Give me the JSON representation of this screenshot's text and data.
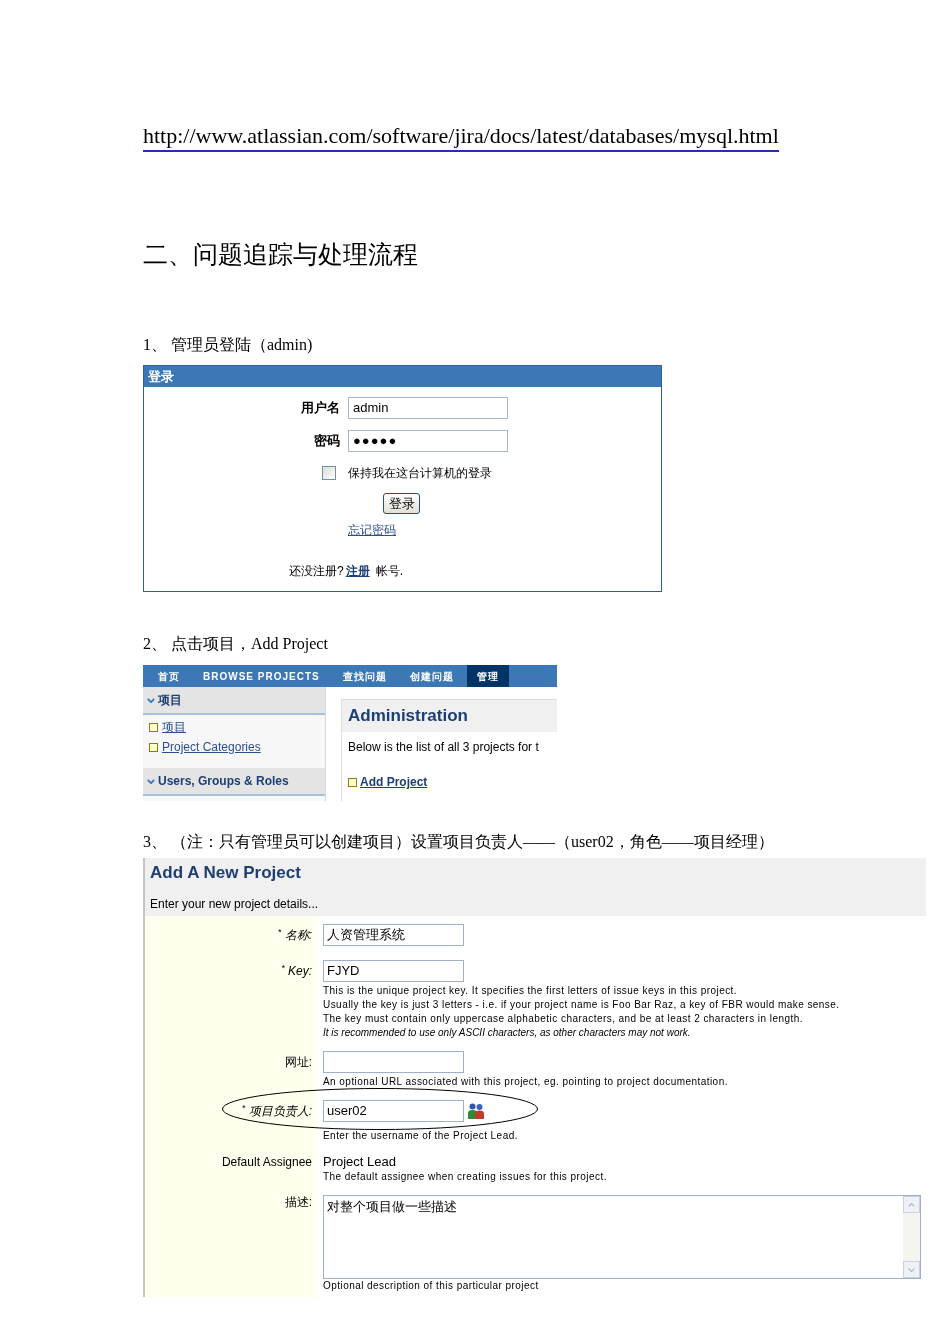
{
  "reference_link": "http://www.atlassian.com/software/jira/docs/latest/databases/mysql.html",
  "section_heading": "二、问题追踪与处理流程",
  "steps": [
    {
      "caption": "1、 管理员登陆（admin)",
      "screenshot": {
        "kind": "login",
        "title": "登录",
        "fields": [
          {
            "kind": "text",
            "label": "用户名",
            "value": "admin"
          },
          {
            "kind": "password",
            "label": "密码",
            "value": "●●●●●"
          }
        ],
        "remember": {
          "label": "保持我在这台计算机的登录",
          "checked": false
        },
        "submit_button": "登录",
        "forgot_link": "忘记密码",
        "signup": {
          "prefix": "还没注册?",
          "link": "注册",
          "suffix": "帐号."
        }
      }
    },
    {
      "caption": "2、 点击项目，Add Project",
      "screenshot": {
        "kind": "admin",
        "nav": [
          {
            "label": "首页",
            "selected": false
          },
          {
            "label": "BROWSE PROJECTS",
            "selected": false
          },
          {
            "label": "查找问题",
            "selected": false
          },
          {
            "label": "创建问题",
            "selected": false
          },
          {
            "label": "管理",
            "selected": true
          }
        ],
        "sidebar": [
          {
            "title": "项目",
            "expanded": true,
            "items": [
              "项目",
              "Project Categories"
            ]
          },
          {
            "title": "Users, Groups & Roles",
            "expanded": true
          }
        ],
        "panel": {
          "title": "Administration",
          "text": "Below is the list of all 3 projects for t",
          "link": "Add Project"
        }
      }
    },
    {
      "caption": "3、 （注：只有管理员可以创建项目）设置项目负责人——（user02，角色——项目经理）",
      "screenshot": {
        "kind": "add_project",
        "title": "Add A New Project",
        "intro": "Enter your new project details...",
        "rows": [
          {
            "kind": "input",
            "label": "$^{*}$ 名称:",
            "required": true,
            "value": "人资管理系统",
            "highlighted": false
          },
          {
            "kind": "input",
            "label": "$^{*}$ Key:",
            "required": true,
            "value": "FJYD",
            "help": [
              "This is the unique project key. It specifies the first letters of issue keys in this project.",
              "Usually the key is just 3 letters - i.e. if your project name is Foo Bar Raz, a key of FBR would make sense.",
              "The key must contain only uppercase alphabetic characters, and be at least 2 characters in length."
            ],
            "note": "It is recommended to use only ASCII characters, as other characters may not work.",
            "highlighted": false
          },
          {
            "kind": "input",
            "label": "网址:",
            "required": false,
            "help": [
              "An optional URL associated with this project, eg. pointing to project documentation."
            ],
            "highlighted": false
          },
          {
            "kind": "user_picker",
            "label": "$^{*}$ 项目负责人:",
            "required": true,
            "value": "user02",
            "help": [
              "Enter the username of the Project Lead."
            ],
            "highlighted": true
          },
          {
            "kind": "static",
            "label": "Default Assignee",
            "required": false,
            "value": "Project Lead",
            "help": [
              "The default assignee when creating issues for this project."
            ],
            "highlighted": false
          },
          {
            "kind": "textarea",
            "label": "描述:",
            "required": false,
            "value": "对整个项目做一些描述",
            "help": [
              "Optional description of this particular project"
            ],
            "highlighted": false
          }
        ]
      }
    }
  ]
}
